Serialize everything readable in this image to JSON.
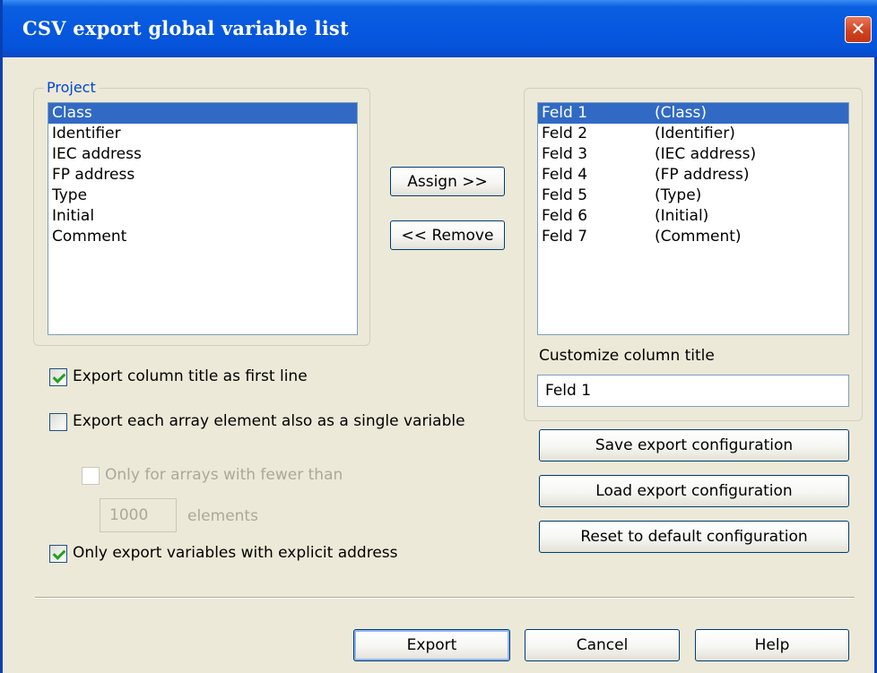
{
  "window": {
    "title": "CSV export global variable list",
    "close_glyph": "✕"
  },
  "project_group": {
    "legend": "Project",
    "items": [
      "Class",
      "Identifier",
      "IEC address",
      "FP address",
      "Type",
      "Initial",
      "Comment"
    ],
    "selected_index": 0
  },
  "assign_button": "Assign >>",
  "remove_button": "<< Remove",
  "fields_list": {
    "items": [
      {
        "field": "Feld 1",
        "column": "(Class)"
      },
      {
        "field": "Feld 2",
        "column": "(Identifier)"
      },
      {
        "field": "Feld 3",
        "column": "(IEC address)"
      },
      {
        "field": "Feld 4",
        "column": "(FP address)"
      },
      {
        "field": "Feld 5",
        "column": "(Type)"
      },
      {
        "field": "Feld 6",
        "column": "(Initial)"
      },
      {
        "field": "Feld 7",
        "column": "(Comment)"
      }
    ],
    "selected_index": 0
  },
  "customize": {
    "label": "Customize column title",
    "value": "Feld 1"
  },
  "options": {
    "export_title_first_line": {
      "label": "Export column title as first line",
      "checked": true
    },
    "export_array_elements": {
      "label": "Export each array element also as a single variable",
      "checked": false
    },
    "only_arrays_fewer": {
      "label": "Only for arrays with fewer than",
      "checked": false,
      "disabled": true
    },
    "array_limit": {
      "value": "1000",
      "unit_label": "elements"
    },
    "only_explicit_address": {
      "label": "Only export variables with explicit address",
      "checked": true
    }
  },
  "config_buttons": {
    "save": "Save export configuration",
    "load": "Load export configuration",
    "reset": "Reset to default configuration"
  },
  "footer_buttons": {
    "export": "Export",
    "cancel": "Cancel",
    "help": "Help"
  }
}
